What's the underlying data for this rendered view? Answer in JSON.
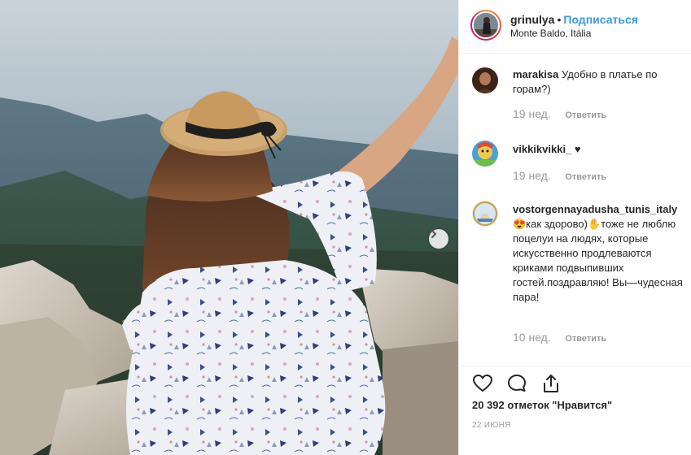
{
  "post": {
    "photo_alt": "",
    "next_icon": "chevron-right-icon"
  },
  "header": {
    "username": "grinulya",
    "separator": "•",
    "follow_label": "Подписаться",
    "location": "Monte Baldo, Itália"
  },
  "comments": [
    {
      "user": "marakisa",
      "text": "Удобно в платье по горам?)",
      "time": "19 нед.",
      "reply": "Ответить"
    },
    {
      "user": "vikkikvikki_",
      "text": "♥",
      "time": "19 нед.",
      "reply": "Ответить"
    },
    {
      "user": "vostorgennayadusha_tunis_italy",
      "text": "😍как здорово)✋тоже не люблю поцелуи на людях, которые искусственно продлеваются криками подвыпивших гостей.поздравляю! Вы—чудесная пара!",
      "time": "10 нед.",
      "reply": "Ответить"
    }
  ],
  "actions": {
    "like_icon": "heart-icon",
    "comment_icon": "comment-bubble-icon",
    "share_icon": "share-upload-icon",
    "likes_text": "20 392 отметок \"Нравится\"",
    "date": "22 июня"
  }
}
